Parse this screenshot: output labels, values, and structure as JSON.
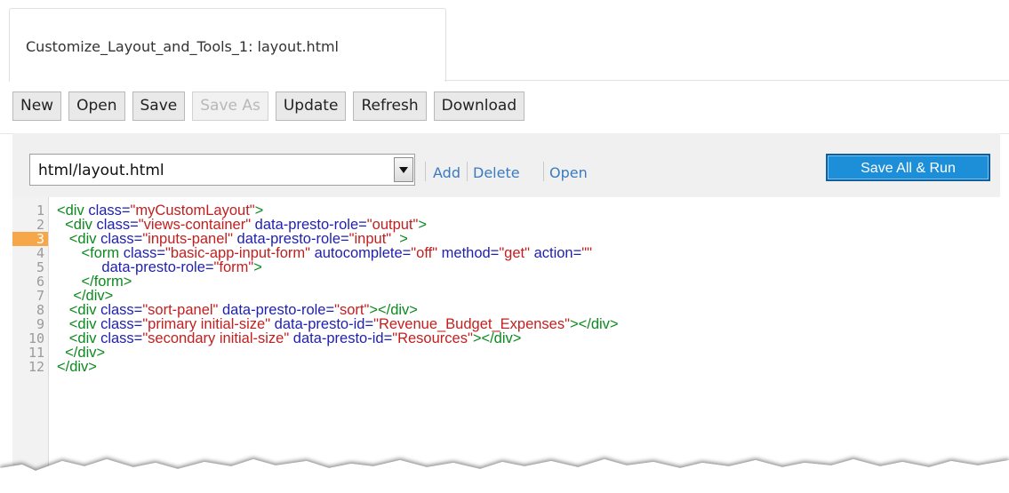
{
  "tab": {
    "title": "Customize_Layout_and_Tools_1: layout.html"
  },
  "toolbar": {
    "buttons": [
      {
        "label": "New",
        "enabled": true
      },
      {
        "label": "Open",
        "enabled": true
      },
      {
        "label": "Save",
        "enabled": true
      },
      {
        "label": "Save As",
        "enabled": false
      },
      {
        "label": "Update",
        "enabled": true
      },
      {
        "label": "Refresh",
        "enabled": true
      },
      {
        "label": "Download",
        "enabled": true
      }
    ]
  },
  "file_bar": {
    "selected_file": "html/layout.html",
    "links": {
      "add": "Add",
      "delete": "Delete",
      "open": "Open"
    },
    "run_label": "Save All & Run"
  },
  "editor": {
    "active_line": 3,
    "line_numbers": [
      "1",
      "2",
      "3",
      "4",
      "5",
      "6",
      "7",
      "8",
      "9",
      "10",
      "11",
      "12"
    ],
    "lines": [
      [
        [
          "t",
          "<div "
        ],
        [
          "a",
          "class="
        ],
        [
          "s",
          "\"myCustomLayout\""
        ],
        [
          "t",
          ">"
        ]
      ],
      [
        [
          "t",
          "  <div "
        ],
        [
          "a",
          "class="
        ],
        [
          "s",
          "\"views-container\""
        ],
        [
          "a",
          " data-presto-role="
        ],
        [
          "s",
          "\"output\""
        ],
        [
          "t",
          ">"
        ]
      ],
      [
        [
          "t",
          "   <div "
        ],
        [
          "a",
          "class="
        ],
        [
          "s",
          "\"inputs-panel\""
        ],
        [
          "a",
          " data-presto-role="
        ],
        [
          "s",
          "\"input\""
        ],
        [
          "t",
          "  >"
        ]
      ],
      [
        [
          "t",
          "      <form "
        ],
        [
          "a",
          "class="
        ],
        [
          "s",
          "\"basic-app-input-form\""
        ],
        [
          "a",
          " autocomplete="
        ],
        [
          "s",
          "\"off\""
        ],
        [
          "a",
          " method="
        ],
        [
          "s",
          "\"get\""
        ],
        [
          "a",
          " action="
        ],
        [
          "s",
          "\"\""
        ]
      ],
      [
        [
          "a",
          "           data-presto-role="
        ],
        [
          "s",
          "\"form\""
        ],
        [
          "t",
          ">"
        ]
      ],
      [
        [
          "t",
          "      </form>"
        ]
      ],
      [
        [
          "t",
          "    </div>"
        ]
      ],
      [
        [
          "t",
          "   <div "
        ],
        [
          "a",
          "class="
        ],
        [
          "s",
          "\"sort-panel\""
        ],
        [
          "a",
          " data-presto-role="
        ],
        [
          "s",
          "\"sort\""
        ],
        [
          "t",
          "></div>"
        ]
      ],
      [
        [
          "t",
          "   <div "
        ],
        [
          "a",
          "class="
        ],
        [
          "s",
          "\"primary initial-size\""
        ],
        [
          "a",
          " data-presto-id="
        ],
        [
          "s",
          "\"Revenue_Budget_Expenses\""
        ],
        [
          "t",
          "></div>"
        ]
      ],
      [
        [
          "t",
          "   <div "
        ],
        [
          "a",
          "class="
        ],
        [
          "s",
          "\"secondary initial-size\""
        ],
        [
          "a",
          " data-presto-id="
        ],
        [
          "s",
          "\"Resources\""
        ],
        [
          "t",
          "></div>"
        ]
      ],
      [
        [
          "t",
          "  </div>"
        ]
      ],
      [
        [
          "t",
          "</div>"
        ]
      ]
    ]
  },
  "colors": {
    "tag": "#0b8a1e",
    "attribute": "#1f1fb0",
    "string": "#c21f1f",
    "run_button": "#1d8fd8",
    "active_line_marker": "#f5a74a",
    "link": "#3a7bbf"
  }
}
